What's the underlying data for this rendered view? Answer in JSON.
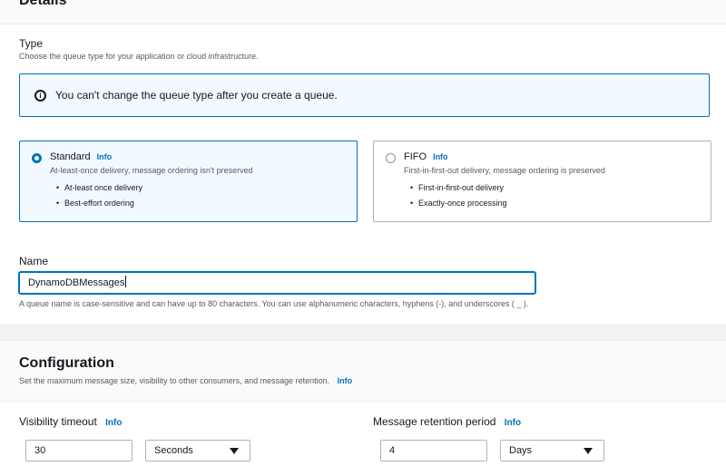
{
  "details": {
    "title": "Details",
    "type": {
      "label": "Type",
      "description": "Choose the queue type for your application or cloud infrastructure."
    },
    "alert": {
      "icon": "info-circle-icon",
      "icon_glyph": "i",
      "text": "You can't change the queue type after you create a queue."
    },
    "options": [
      {
        "title": "Standard",
        "info": "Info",
        "selected": true,
        "description": "At-least-once delivery, message ordering isn't preserved",
        "bullets": [
          "At-least once delivery",
          "Best-effort ordering"
        ]
      },
      {
        "title": "FIFO",
        "info": "Info",
        "selected": false,
        "description": "First-in-first-out delivery, message ordering is preserved",
        "bullets": [
          "First-in-first-out delivery",
          "Exactly-once processing"
        ]
      }
    ],
    "name": {
      "label": "Name",
      "value": "DynamoDBMessages",
      "constraint": "A queue name is case-sensitive and can have up to 80 characters. You can use alphanumeric characters, hyphens (-), and underscores ( _ )."
    }
  },
  "configuration": {
    "title": "Configuration",
    "description": "Set the maximum message size, visibility to other consumers, and message retention.",
    "info": "Info",
    "visibility_timeout": {
      "label": "Visibility timeout",
      "info": "Info",
      "value": "30",
      "unit": "Seconds"
    },
    "message_retention": {
      "label": "Message retention period",
      "info": "Info",
      "value": "4",
      "unit": "Days"
    }
  },
  "colors": {
    "accent": "#0073bb",
    "selected_bg": "#f1faff",
    "text": "#16191f",
    "muted": "#545b64"
  }
}
